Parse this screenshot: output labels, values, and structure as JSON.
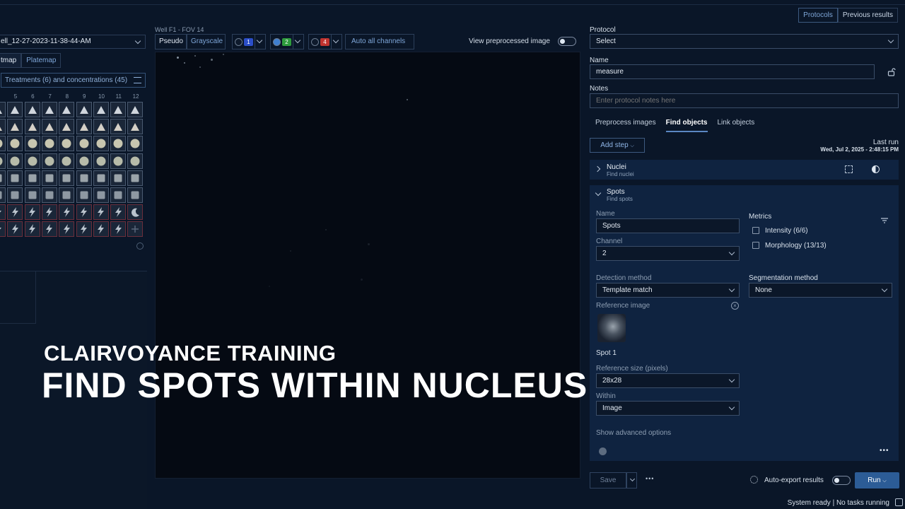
{
  "header": {
    "tabs": [
      {
        "label": "Protocols",
        "active": true
      },
      {
        "label": "Previous results",
        "active": false
      }
    ]
  },
  "plate": {
    "experiment_value": "ell_12-27-2023-11-38-44-AM",
    "view_tabs": [
      "tmap",
      "Platemap"
    ],
    "treatments_label": "Treatments (6) and concentrations (45)",
    "columns": [
      "5",
      "6",
      "7",
      "8",
      "9",
      "10",
      "11",
      "12"
    ],
    "rows": [
      {
        "shape": "triangle",
        "count": 9,
        "tone": "#cfd5dc"
      },
      {
        "shape": "triangle",
        "count": 9,
        "tone": "#d4cfc6"
      },
      {
        "shape": "circle",
        "count": 9,
        "tone": "#c8c6b0"
      },
      {
        "shape": "circle",
        "count": 9,
        "tone": "#b7bba9"
      },
      {
        "shape": "square",
        "count": 9,
        "tone": "#9aa3a9"
      },
      {
        "shape": "square",
        "count": 9,
        "tone": "#8e98a2"
      },
      {
        "shape": "bolt",
        "count": 9,
        "tone": "#b9c2cc",
        "red": true,
        "last": "moon"
      },
      {
        "shape": "bolt",
        "count": 9,
        "tone": "#b9c2cc",
        "red": true,
        "last": "plus"
      }
    ]
  },
  "viewer": {
    "title": "Well F1 - FOV 14",
    "mode_buttons": [
      {
        "label": "Pseudo",
        "active": true
      },
      {
        "label": "Grayscale",
        "active": false
      }
    ],
    "channels": [
      {
        "num": "1",
        "color": "#2b4ec8",
        "dot": "#0e1a2c"
      },
      {
        "num": "2",
        "color": "#2e9c3d",
        "dot": "#3f7fd0"
      },
      {
        "num": "4",
        "color": "#c0332f",
        "dot": "#0e1a2c"
      }
    ],
    "auto_label": "Auto all channels",
    "preprocessed_label": "View preprocessed image"
  },
  "overlay": {
    "subtitle": "CLAIRVOYANCE TRAINING",
    "title": "FIND SPOTS WITHIN NUCLEUS"
  },
  "protocol": {
    "protocol_label": "Protocol",
    "protocol_value": "Select",
    "name_label": "Name",
    "name_value": "measure",
    "notes_label": "Notes",
    "notes_placeholder": "Enter protocol notes here",
    "tabs": [
      {
        "label": "Preprocess images",
        "active": false
      },
      {
        "label": "Find objects",
        "active": true
      },
      {
        "label": "Link objects",
        "active": false
      }
    ],
    "add_step": "Add step",
    "last_run_label": "Last run",
    "last_run_value": "Wed, Jul 2, 2025 - 2:48:15 PM",
    "nuclei_title": "Nuclei",
    "nuclei_sub": "Find nuclei",
    "spots_title": "Spots",
    "spots_sub": "Find spots",
    "spot_name_label": "Name",
    "spot_name_value": "Spots",
    "channel_label": "Channel",
    "channel_value": "2",
    "metrics_label": "Metrics",
    "metrics": [
      "Intensity (6/6)",
      "Morphology (13/13)"
    ],
    "detection_label": "Detection method",
    "detection_value": "Template match",
    "segmentation_label": "Segmentation method",
    "segmentation_value": "None",
    "reference_label": "Reference image",
    "reference_caption": "Spot 1",
    "ref_size_label": "Reference size (pixels)",
    "ref_size_value": "28x28",
    "within_label": "Within",
    "within_value": "Image",
    "advanced_label": "Show advanced options",
    "save_label": "Save",
    "auto_export_label": "Auto-export results",
    "run_label": "Run",
    "status": "System ready | No tasks running"
  }
}
